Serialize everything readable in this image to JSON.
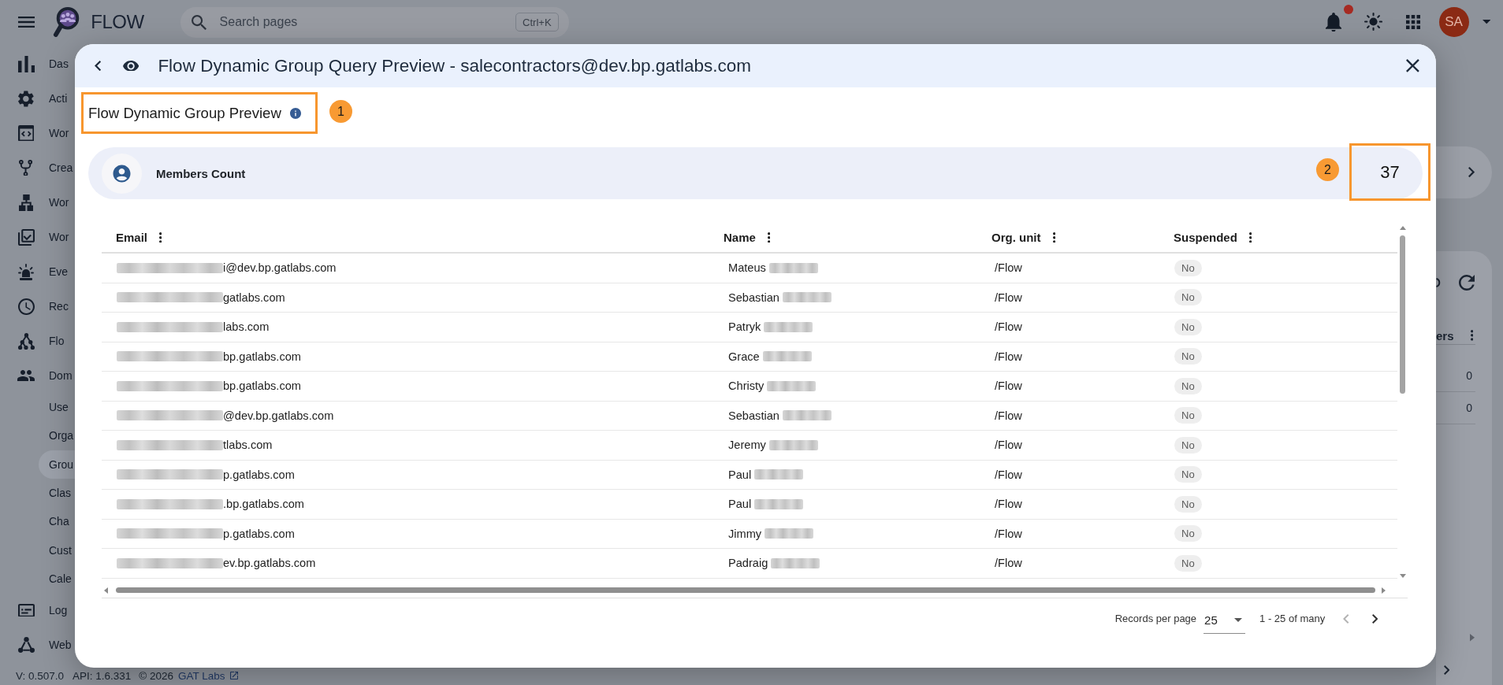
{
  "app_bar": {
    "logo_text": "FLOW",
    "search": {
      "placeholder": "Search pages",
      "shortcut": "Ctrl+K"
    },
    "notifications": {
      "unread": true
    },
    "avatar": {
      "initials": "SA"
    }
  },
  "sidebar": {
    "items": [
      {
        "label": "Das",
        "selected": false
      },
      {
        "label": "Acti",
        "selected": false
      },
      {
        "label": "Wor",
        "selected": false
      },
      {
        "label": "Crea",
        "selected": false
      },
      {
        "label": "Wor",
        "selected": false
      },
      {
        "label": "Wor",
        "selected": false
      },
      {
        "label": "Eve",
        "selected": false
      },
      {
        "label": "Rec",
        "selected": false
      },
      {
        "label": "Flo",
        "selected": false
      },
      {
        "label": "Dom",
        "selected": false,
        "children": [
          {
            "label": "Use",
            "selected": false
          },
          {
            "label": "Orga",
            "selected": false
          },
          {
            "label": "Grou",
            "selected": true
          },
          {
            "label": "Clas",
            "selected": false
          },
          {
            "label": "Cha",
            "selected": false
          },
          {
            "label": "Cust",
            "selected": false
          },
          {
            "label": "Cale",
            "selected": false
          }
        ]
      },
      {
        "label": "Log",
        "selected": false
      },
      {
        "label": "Web",
        "selected": false
      }
    ],
    "footer": {
      "version": "V: 0.507.0",
      "api": "API: 1.6.331",
      "copyright": "© 2026",
      "link": "GAT Labs"
    }
  },
  "background": {
    "column_header": "ers",
    "values": [
      "0",
      "0"
    ]
  },
  "dialog": {
    "title": "Flow Dynamic Group Query Preview - salecontractors@dev.bp.gatlabs.com",
    "preview": {
      "title": "Flow Dynamic Group Preview",
      "marker": "1"
    },
    "summary": {
      "label": "Members Count",
      "count": "37",
      "marker": "2"
    },
    "table": {
      "columns": [
        {
          "label": "Email"
        },
        {
          "label": "Name"
        },
        {
          "label": "Org. unit"
        },
        {
          "label": "Suspended"
        }
      ],
      "rows": [
        {
          "email": "i@dev.bp.gatlabs.com",
          "name": "Mateus",
          "org_unit": "/Flow",
          "suspended": "No"
        },
        {
          "email": "gatlabs.com",
          "name": "Sebastian",
          "org_unit": "/Flow",
          "suspended": "No"
        },
        {
          "email": "labs.com",
          "name": "Patryk",
          "org_unit": "/Flow",
          "suspended": "No"
        },
        {
          "email": "bp.gatlabs.com",
          "name": "Grace",
          "org_unit": "/Flow",
          "suspended": "No"
        },
        {
          "email": "bp.gatlabs.com",
          "name": "Christy",
          "org_unit": "/Flow",
          "suspended": "No"
        },
        {
          "email": "@dev.bp.gatlabs.com",
          "name": "Sebastian",
          "org_unit": "/Flow",
          "suspended": "No"
        },
        {
          "email": "tlabs.com",
          "name": "Jeremy",
          "org_unit": "/Flow",
          "suspended": "No"
        },
        {
          "email": "p.gatlabs.com",
          "name": "Paul",
          "org_unit": "/Flow",
          "suspended": "No"
        },
        {
          "email": ".bp.gatlabs.com",
          "name": "Paul",
          "org_unit": "/Flow",
          "suspended": "No"
        },
        {
          "email": "p.gatlabs.com",
          "name": "Jimmy",
          "org_unit": "/Flow",
          "suspended": "No"
        },
        {
          "email": "ev.bp.gatlabs.com",
          "name": "Padraig",
          "org_unit": "/Flow",
          "suspended": "No"
        }
      ]
    },
    "pagination": {
      "label": "Records per page",
      "page_size": "25",
      "range": "1 - 25 of many",
      "previous": {
        "disabled": true
      },
      "next": {
        "disabled": false
      }
    }
  }
}
